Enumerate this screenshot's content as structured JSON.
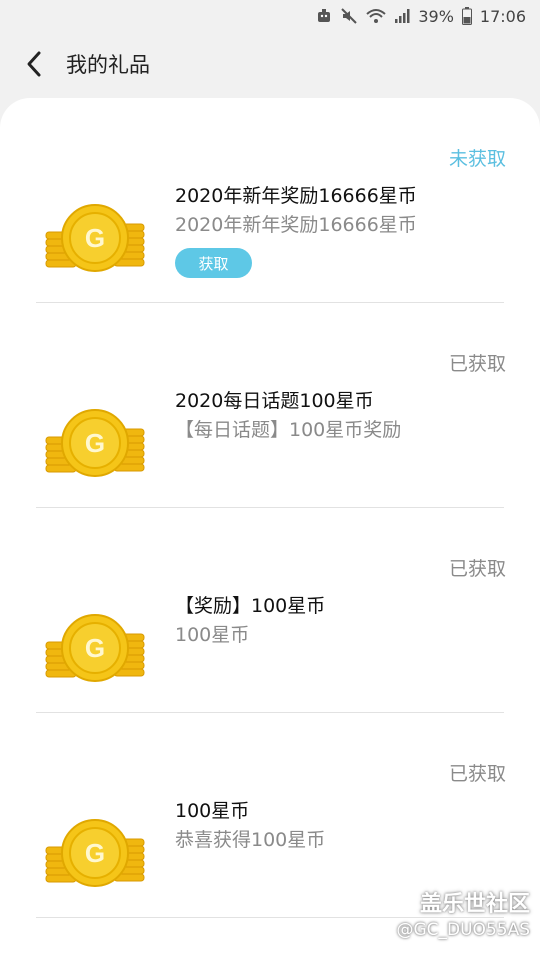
{
  "status_bar": {
    "battery_percent": "39%",
    "time": "17:06"
  },
  "header": {
    "title": "我的礼品"
  },
  "gifts": [
    {
      "status": "未获取",
      "title": "2020年新年奖励16666星币",
      "subtitle": "2020年新年奖励16666星币",
      "button_label": "获取"
    },
    {
      "status": "已获取",
      "title": "2020每日话题100星币",
      "subtitle": "【每日话题】100星币奖励"
    },
    {
      "status": "已获取",
      "title": "【奖励】100星币",
      "subtitle": "100星币"
    },
    {
      "status": "已获取",
      "title": "100星币",
      "subtitle": "恭喜获得100星币"
    }
  ],
  "watermark": {
    "brand": "盖乐世社区",
    "user": "@GC_DUO55AS"
  },
  "colors": {
    "accent": "#5ec8e6",
    "pending_status": "#5bbfe0",
    "coin_gold": "#f5c518"
  }
}
